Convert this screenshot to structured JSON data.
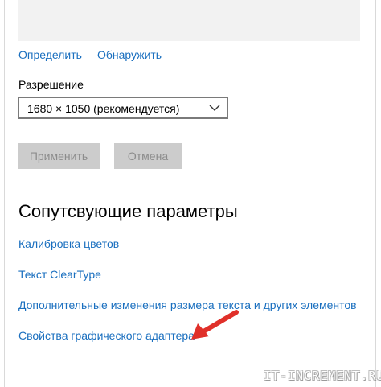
{
  "display": {
    "identify_link": "Определить",
    "detect_link": "Обнаружить",
    "resolution_label": "Разрешение",
    "resolution_value": "1680 × 1050 (рекомендуется)",
    "apply_button": "Применить",
    "cancel_button": "Отмена"
  },
  "related": {
    "heading": "Сопутсвующие параметры",
    "links": [
      "Калибровка цветов",
      "Текст ClearType",
      "Дополнительные изменения размера текста и других элементов",
      "Свойства графического адаптера"
    ]
  },
  "watermark": "IT-INCREMENT.RU",
  "colors": {
    "link": "#1a6fbf",
    "disabled_button_bg": "#cccccc",
    "disabled_button_text": "#8c8c8c",
    "arrow": "#e0302a"
  },
  "icons": {
    "dropdown": "chevron-down-icon",
    "annotation": "arrow-icon"
  }
}
